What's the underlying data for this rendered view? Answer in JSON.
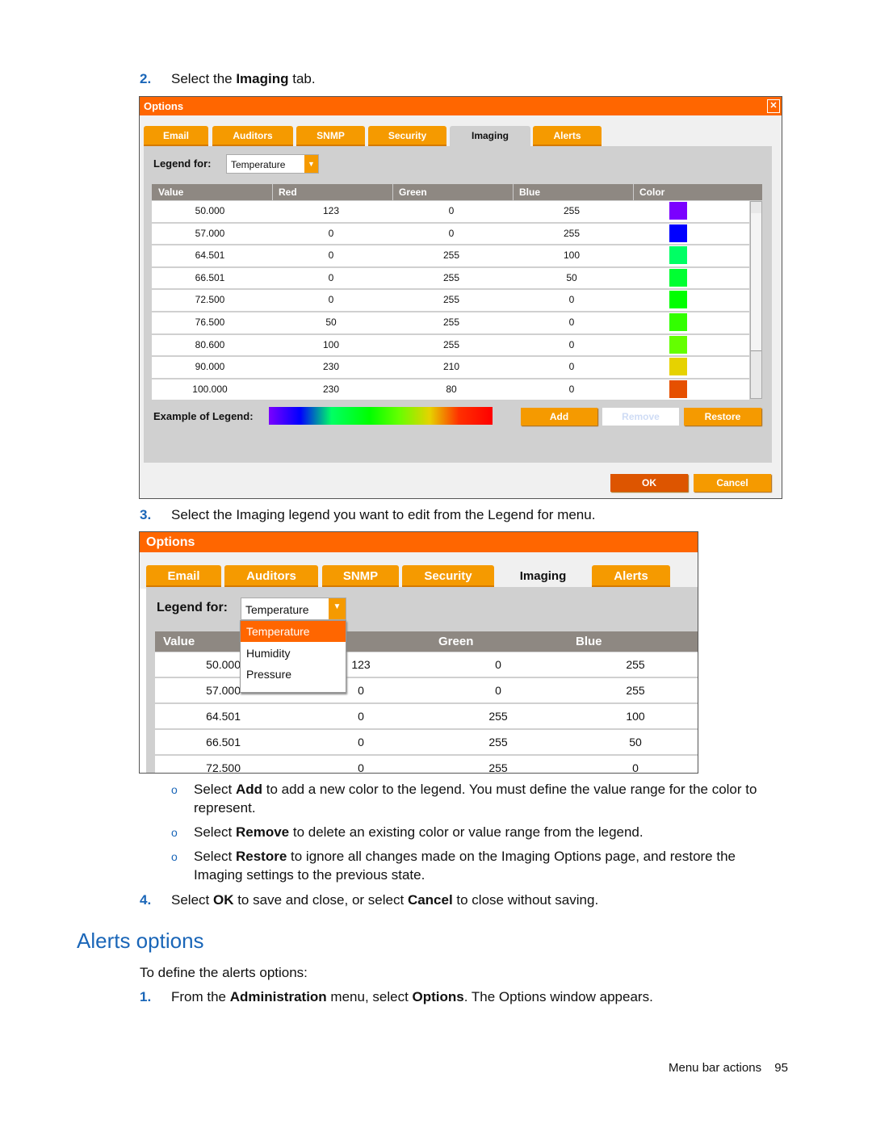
{
  "step2": {
    "num": "2.",
    "pre": "Select the ",
    "bold": "Imaging",
    "post": " tab."
  },
  "dialog1": {
    "title": "Options",
    "close_icon": "close-x-icon",
    "tabs": [
      "Email",
      "Auditors",
      "SNMP",
      "Security",
      "Imaging",
      "Alerts"
    ],
    "active_tab": "Imaging",
    "legend_label": "Legend for:",
    "legend_value": "Temperature",
    "columns": [
      "Value",
      "Red",
      "Green",
      "Blue",
      "Color"
    ],
    "rows": [
      {
        "value": "50.000",
        "red": "123",
        "green": "0",
        "blue": "255",
        "color": "#7b00ff"
      },
      {
        "value": "57.000",
        "red": "0",
        "green": "0",
        "blue": "255",
        "color": "#0000ff"
      },
      {
        "value": "64.501",
        "red": "0",
        "green": "255",
        "blue": "100",
        "color": "#00ff64"
      },
      {
        "value": "66.501",
        "red": "0",
        "green": "255",
        "blue": "50",
        "color": "#00ff32"
      },
      {
        "value": "72.500",
        "red": "0",
        "green": "255",
        "blue": "0",
        "color": "#00ff00"
      },
      {
        "value": "76.500",
        "red": "50",
        "green": "255",
        "blue": "0",
        "color": "#32ff00"
      },
      {
        "value": "80.600",
        "red": "100",
        "green": "255",
        "blue": "0",
        "color": "#64ff00"
      },
      {
        "value": "90.000",
        "red": "230",
        "green": "210",
        "blue": "0",
        "color": "#e6d200"
      },
      {
        "value": "100.000",
        "red": "230",
        "green": "80",
        "blue": "0",
        "color": "#e65000"
      }
    ],
    "example_label": "Example of Legend:",
    "add": "Add",
    "remove": "Remove",
    "restore": "Restore",
    "ok": "OK",
    "cancel": "Cancel"
  },
  "step3": {
    "num": "3.",
    "text": "Select the Imaging legend you want to edit from the Legend for menu."
  },
  "dialog2": {
    "title": "Options",
    "tabs": [
      "Email",
      "Auditors",
      "SNMP",
      "Security",
      "Imaging",
      "Alerts"
    ],
    "legend_label": "Legend for:",
    "legend_value": "Temperature",
    "options": [
      "Temperature",
      "Humidity",
      "Pressure"
    ],
    "selected_option": "Temperature",
    "columns": [
      "Value",
      "Green",
      "Blue"
    ],
    "rows": [
      {
        "value": "50.000",
        "red": "123",
        "green": "0",
        "blue": "255"
      },
      {
        "value": "57.000",
        "red": "0",
        "green": "0",
        "blue": "255"
      },
      {
        "value": "64.501",
        "red": "0",
        "green": "255",
        "blue": "100"
      },
      {
        "value": "66.501",
        "red": "0",
        "green": "255",
        "blue": "50"
      },
      {
        "value": "72.500",
        "red": "0",
        "green": "255",
        "blue": "0"
      }
    ]
  },
  "bullets": [
    {
      "pre": "Select ",
      "bold": "Add",
      "post": " to add a new color to the legend. You must define the value range for the color to",
      "line2": "represent."
    },
    {
      "pre": "Select ",
      "bold": "Remove",
      "post": " to delete an existing color or value range from the legend.",
      "line2": ""
    },
    {
      "pre": "Select ",
      "bold": "Restore",
      "post": " to ignore all changes made on the Imaging Options page, and restore the",
      "line2": "Imaging settings to the previous state."
    }
  ],
  "step4": {
    "num": "4.",
    "a": "Select ",
    "b1": "OK",
    "c": " to save and close, or select ",
    "b2": "Cancel",
    "d": " to close without saving."
  },
  "section": {
    "heading": "Alerts options",
    "intro": "To define the alerts options:"
  },
  "step1": {
    "num": "1.",
    "a": "From the ",
    "b1": "Administration",
    "c": " menu, select ",
    "b2": "Options",
    "d": ". The Options window appears."
  },
  "footer": {
    "section": "Menu bar actions",
    "page": "95"
  },
  "colors": {
    "accent": "#ff6600",
    "tab": "#f59a00",
    "heading": "#1a66b8"
  }
}
